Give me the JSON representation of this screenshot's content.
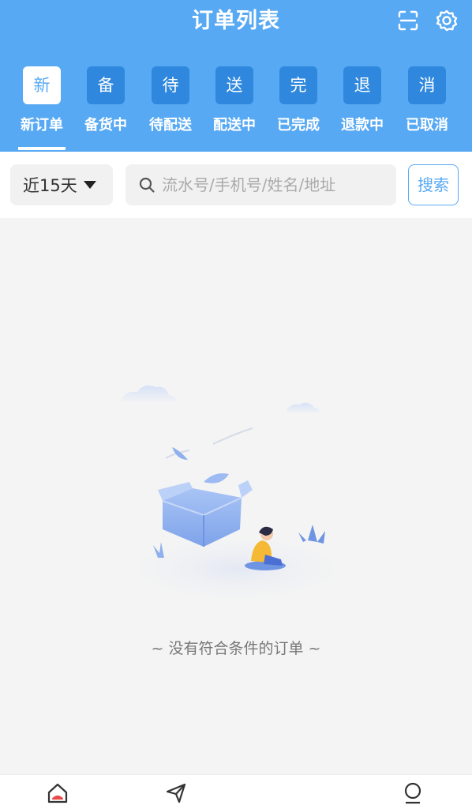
{
  "header": {
    "title": "订单列表",
    "icons": [
      "scan-icon",
      "settings-gear-icon"
    ]
  },
  "tabs": [
    {
      "glyph": "新",
      "label": "新订单",
      "active": true
    },
    {
      "glyph": "备",
      "label": "备货中",
      "active": false
    },
    {
      "glyph": "待",
      "label": "待配送",
      "active": false
    },
    {
      "glyph": "送",
      "label": "配送中",
      "active": false
    },
    {
      "glyph": "完",
      "label": "已完成",
      "active": false
    },
    {
      "glyph": "退",
      "label": "退款中",
      "active": false
    },
    {
      "glyph": "消",
      "label": "已取消",
      "active": false
    }
  ],
  "filter": {
    "range_label": "近15天",
    "search_placeholder": "流水号/手机号/姓名/地址",
    "search_button": "搜索"
  },
  "empty": {
    "message": "~ 没有符合条件的订单 ~"
  },
  "bottom_nav": {
    "icons": [
      "home-icon",
      "send-icon",
      "profile-icon"
    ]
  },
  "colors": {
    "primary": "#58a9f3",
    "tab_box": "#2f88de",
    "background": "#f4f4f4"
  }
}
